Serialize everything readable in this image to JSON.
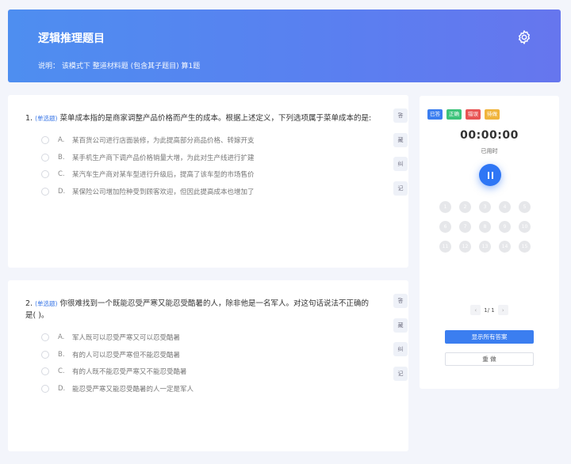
{
  "header": {
    "title": "逻辑推理题目",
    "description": "说明： 该模式下 整道材料题 (包含其子题目) 算1题",
    "settings_icon": "gear-icon"
  },
  "questions": [
    {
      "number": "1.",
      "tag": "(单选题)",
      "text": "菜单成本指的是商家调整产品价格而产生的成本。根据上述定义，下列选项属于菜单成本的是:",
      "options": [
        {
          "letter": "A.",
          "text": "某百货公司进行店面装修，为此提高部分商品价格、转嫁开支"
        },
        {
          "letter": "B.",
          "text": "某手机生产商下调产品价格销量大增，为此对生产线进行扩建"
        },
        {
          "letter": "C.",
          "text": "某汽车生产商对某车型进行升级后，提高了该车型的市场售价"
        },
        {
          "letter": "D.",
          "text": "某保险公司增加险种受到顾客欢迎，但因此提高成本也增加了"
        }
      ],
      "tools": [
        "答",
        "藏",
        "纠",
        "记"
      ]
    },
    {
      "number": "2.",
      "tag": "(单选题)",
      "text": "你很难找到一个既能忍受严寒又能忍受酷暑的人，除非他是一名军人。对这句话说法不正确的是(     )。",
      "options": [
        {
          "letter": "A.",
          "text": "军人既可以忍受严寒又可以忍受酷暑"
        },
        {
          "letter": "B.",
          "text": "有的人可以忍受严寒但不能忍受酷暑"
        },
        {
          "letter": "C.",
          "text": "有的人既不能忍受严寒又不能忍受酷暑"
        },
        {
          "letter": "D.",
          "text": "能忍受严寒又能忍受酷暑的人一定是军人"
        }
      ],
      "tools": [
        "答",
        "藏",
        "纠",
        "记"
      ]
    }
  ],
  "panel": {
    "legend": [
      {
        "label": "已答",
        "color": "#3b7ef0"
      },
      {
        "label": "正确",
        "color": "#3cc37a"
      },
      {
        "label": "错误",
        "color": "#e85454"
      },
      {
        "label": "待做",
        "color": "#f0b43c"
      }
    ],
    "timer": "00:00:00",
    "timer_label": "已用时",
    "numbers": [
      "1",
      "2",
      "3",
      "4",
      "5",
      "6",
      "7",
      "8",
      "9",
      "10",
      "11",
      "12",
      "13",
      "14",
      "15"
    ],
    "pager": {
      "prev": "‹",
      "text": "1/ 1",
      "next": "›"
    },
    "show_answers_label": "显示所有答案",
    "reset_label": "重 做"
  }
}
